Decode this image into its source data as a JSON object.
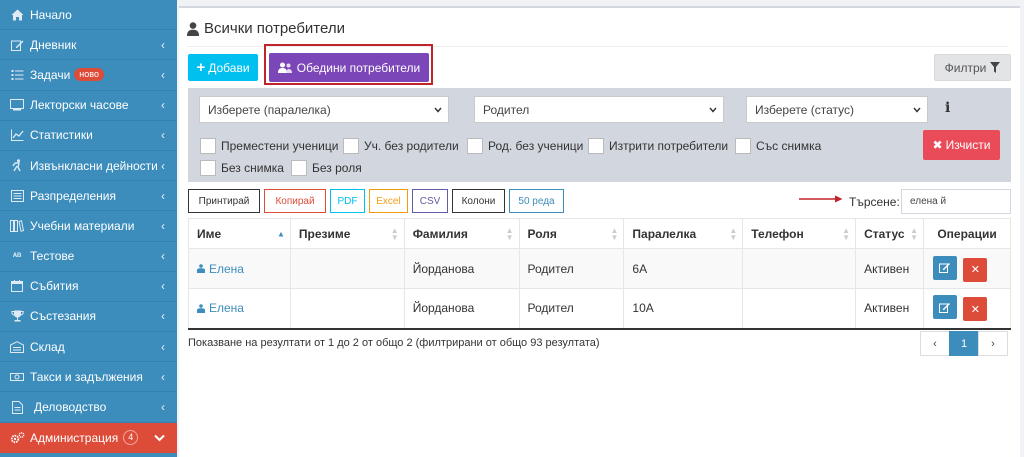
{
  "sidebar": {
    "items": [
      {
        "label": "Начало",
        "icon": "home-icon",
        "chevron": false
      },
      {
        "label": "Дневник",
        "icon": "edit-icon",
        "chevron": true
      },
      {
        "label": "Задачи",
        "icon": "tasks-icon",
        "chevron": true,
        "badge": "ново"
      },
      {
        "label": "Лекторски часове",
        "icon": "chalkboard-icon",
        "chevron": true
      },
      {
        "label": "Статистики",
        "icon": "line-chart-icon",
        "chevron": true
      },
      {
        "label": "Извънкласни дейности",
        "icon": "running-icon",
        "chevron": true
      },
      {
        "label": "Разпределения",
        "icon": "list-alt-icon",
        "chevron": true
      },
      {
        "label": "Учебни материали",
        "icon": "books-icon",
        "chevron": true
      },
      {
        "label": "Тестове",
        "icon": "spellcheck-icon",
        "chevron": true
      },
      {
        "label": "Събития",
        "icon": "calendar-icon",
        "chevron": true
      },
      {
        "label": "Състезания",
        "icon": "trophy-icon",
        "chevron": true
      },
      {
        "label": "Склад",
        "icon": "warehouse-icon",
        "chevron": true
      },
      {
        "label": "Такси и задължения",
        "icon": "money-icon",
        "chevron": true
      },
      {
        "label": "Деловодство",
        "icon": "file-icon",
        "chevron": true
      },
      {
        "label": "Администрация",
        "icon": "gears-icon",
        "chevron": true,
        "badge": "4",
        "active": true
      }
    ]
  },
  "page": {
    "title": "Всички потребители"
  },
  "toolbar": {
    "add_label": "Добави",
    "merge_label": "Обедини потребители",
    "filters_label": "Филтри"
  },
  "filters": {
    "class_select": "Изберете (паралелка)",
    "parent_select": "Родител",
    "status_select": "Изберете (статус)",
    "checkboxes": [
      "Преместени ученици",
      "Уч. без родители",
      "Род. без ученици",
      "Изтрити потребители",
      "Със снимка",
      "Без снимка",
      "Без роля"
    ],
    "clear_label": "Изчисти"
  },
  "export": {
    "print": "Принтирай",
    "copy": "Копирай",
    "pdf": "PDF",
    "excel": "Excel",
    "csv": "CSV",
    "columns": "Колони",
    "rows": "50 реда"
  },
  "search": {
    "label": "Търсене:",
    "value": "елена й"
  },
  "table": {
    "headers": [
      "Име",
      "Презиме",
      "Фамилия",
      "Роля",
      "Паралелка",
      "Телефон",
      "Статус",
      "Операции"
    ],
    "rows": [
      {
        "first": "Елена",
        "middle": "",
        "last": "Йорданова",
        "role": "Родител",
        "class": "6А",
        "phone": "",
        "status": "Активен"
      },
      {
        "first": "Елена",
        "middle": "",
        "last": "Йорданова",
        "role": "Родител",
        "class": "10А",
        "phone": "",
        "status": "Активен"
      }
    ]
  },
  "footer": {
    "info": "Показване на резултати от 1 до 2 от общо 2 (филтрирани от общо 93 резултата)",
    "prev": "‹",
    "current_page": "1",
    "next": "›"
  },
  "colors": {
    "sidebar": "#3c8dbc",
    "active": "#dd4b39",
    "add": "#00c0ef",
    "merge": "#7b46b8",
    "clear": "#e94b58"
  }
}
